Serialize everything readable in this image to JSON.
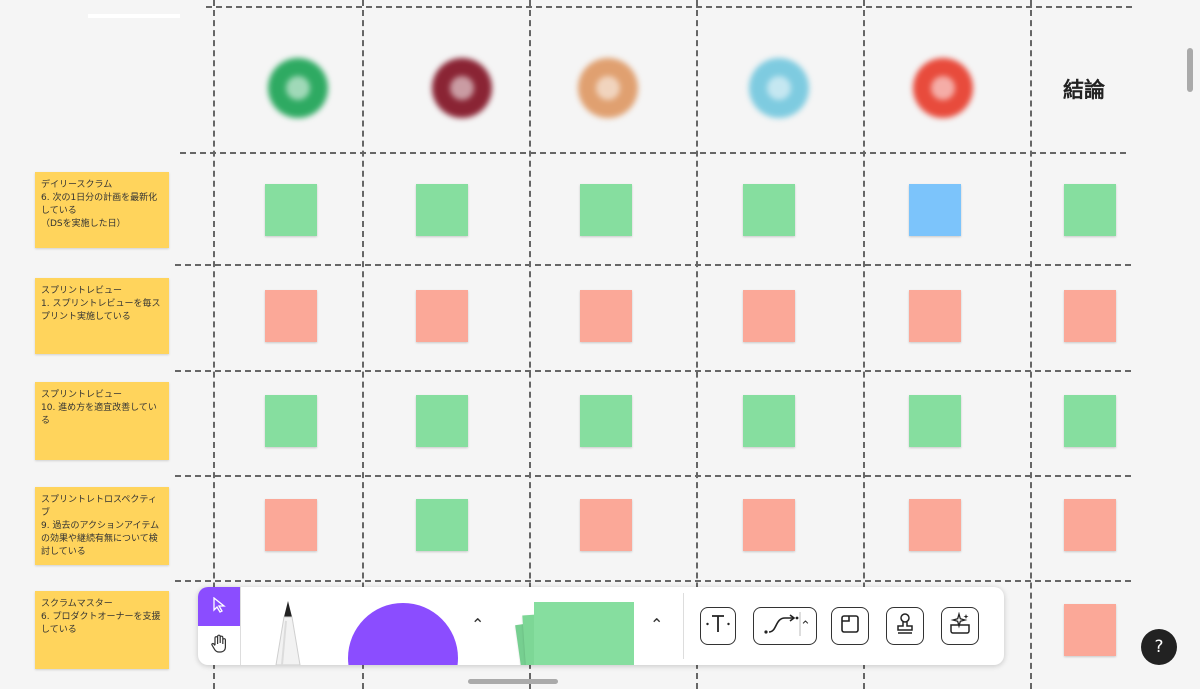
{
  "board": {
    "conclusion_header": "結論",
    "avatar_colors": [
      "#2eaa62",
      "#8a2434",
      "#e0a070",
      "#7ecbe0",
      "#e84b3c"
    ],
    "rows": [
      {
        "label": "デイリースクラム\n6. 次の1日分の計画を最新化している\n（DSを実施した日）",
        "colors": [
          "green",
          "green",
          "green",
          "green",
          "blue",
          "green"
        ]
      },
      {
        "label": "スプリントレビュー\n1. スプリントレビューを毎スプリント実施している",
        "colors": [
          "pink",
          "pink",
          "pink",
          "pink",
          "pink",
          "pink"
        ]
      },
      {
        "label": "スプリントレビュー\n10. 進め方を適宜改善している",
        "colors": [
          "green",
          "green",
          "green",
          "green",
          "green",
          "green"
        ]
      },
      {
        "label": "スプリントレトロスペクティブ\n9. 過去のアクションアイテムの効果や継続有無について検討している",
        "colors": [
          "pink",
          "green",
          "pink",
          "pink",
          "pink",
          "pink"
        ]
      },
      {
        "label": "スクラムマスター\n6. プロダクトオーナーを支援している",
        "colors": [
          "",
          "",
          "",
          "",
          "",
          "pink"
        ]
      }
    ]
  },
  "toolbar": {
    "select_icon": "cursor-arrow-icon",
    "hand_icon": "hand-icon",
    "pen_icon": "marker-pen-icon",
    "shape_color": "#8b4dff",
    "sticky_color": "#86de9f",
    "tools": [
      "text-tool-icon",
      "connector-tool-icon",
      "section-tool-icon",
      "stamp-tool-icon",
      "ai-sparkle-icon"
    ]
  },
  "help": {
    "label": "?"
  }
}
